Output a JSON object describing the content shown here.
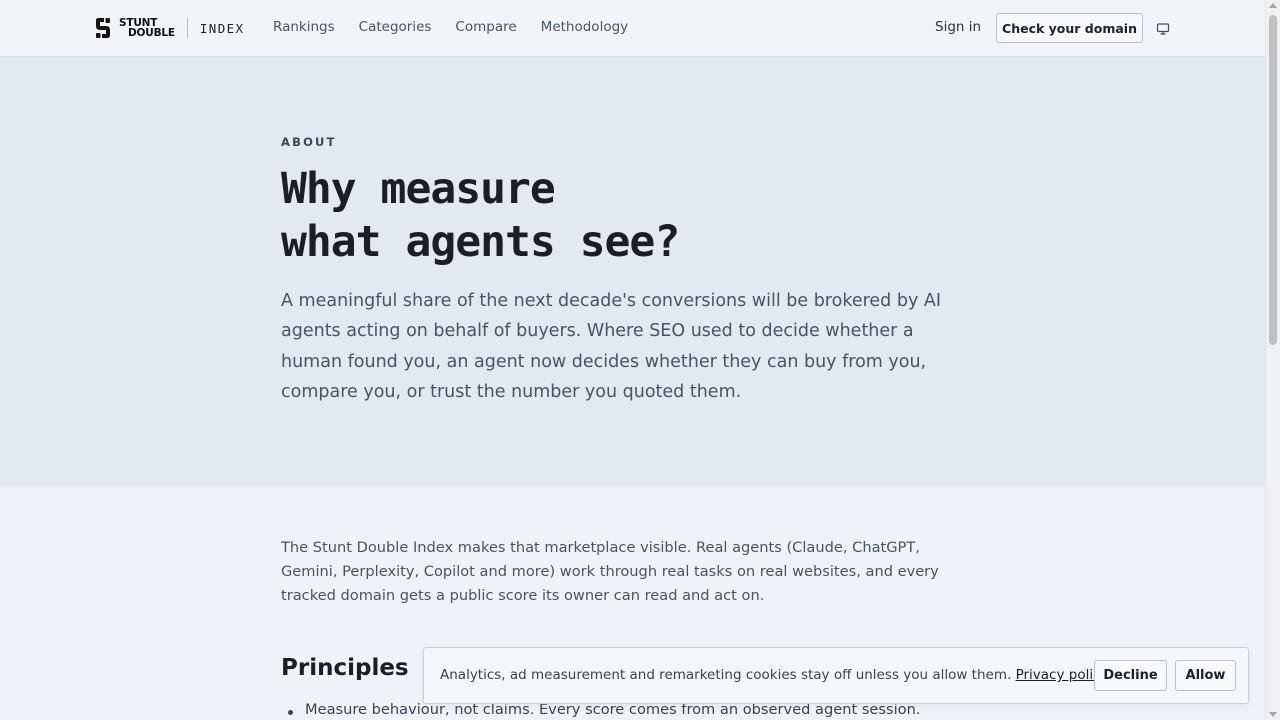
{
  "header": {
    "logo": {
      "line1": "STUNT",
      "line2": "DOUBLE",
      "suffix": "INDEX",
      "icon": "stunt-double-logo-icon"
    },
    "nav": [
      {
        "label": "Rankings"
      },
      {
        "label": "Categories"
      },
      {
        "label": "Compare"
      },
      {
        "label": "Methodology"
      }
    ],
    "sign_in": "Sign in",
    "cta": "Check your domain",
    "theme_icon": "monitor-icon"
  },
  "hero": {
    "eyebrow": "ABOUT",
    "title_line1": "Why measure",
    "title_line2": "what agents see?",
    "lead": "A meaningful share of the next decade's conversions will be brokered by AI agents acting on behalf of buyers. Where SEO used to decide whether a human found you, an agent now decides whether they can buy from you, compare you, or trust the number you quoted them."
  },
  "main": {
    "intro": "The Stunt Double Index makes that marketplace visible. Real agents (Claude, ChatGPT, Gemini, Perplexity, Copilot and more) work through real tasks on real websites, and every tracked domain gets a public score its owner can read and act on.",
    "principles_title": "Principles",
    "principles": [
      "Measure behaviour, not claims. Every score comes from an observed agent session."
    ]
  },
  "cookie_banner": {
    "text": "Analytics, ad measurement and remarketing cookies stay off unless you allow them.",
    "link": "Privacy policy",
    "decline": "Decline",
    "allow": "Allow"
  }
}
